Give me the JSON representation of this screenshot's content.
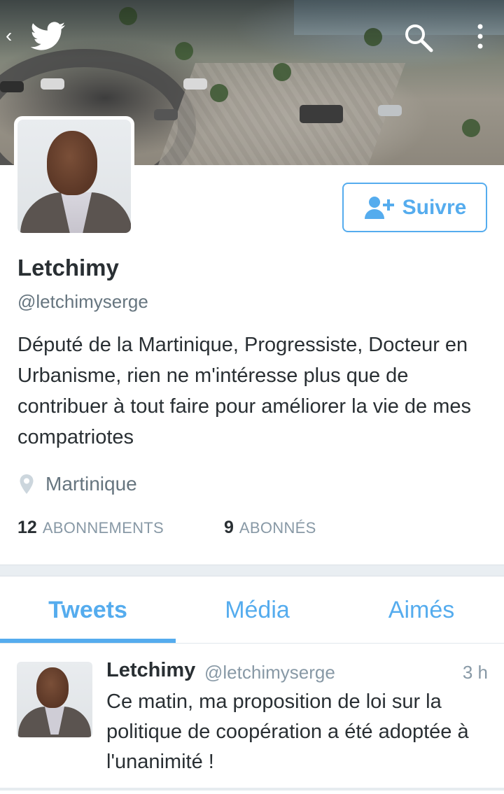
{
  "header": {
    "back_icon": "chevron-left-icon",
    "logo_icon": "twitter-bird-icon",
    "search_icon": "search-icon",
    "more_icon": "more-vertical-icon"
  },
  "profile": {
    "name": "Letchimy",
    "handle": "@letchimyserge",
    "bio": "Député de la Martinique, Progressiste, Docteur en Urbanisme, rien ne m'intéresse plus que de contribuer à  tout faire pour améliorer la vie de mes compatriotes",
    "location": "Martinique",
    "follow_button": "Suivre",
    "stats": {
      "following_count": "12",
      "following_label": "ABONNEMENTS",
      "followers_count": "9",
      "followers_label": "ABONNÉS"
    }
  },
  "tabs": [
    {
      "label": "Tweets",
      "active": true
    },
    {
      "label": "Média",
      "active": false
    },
    {
      "label": "Aimés",
      "active": false
    }
  ],
  "tweet": {
    "name": "Letchimy",
    "handle": "@letchimyserge",
    "time": "3 h",
    "text": "Ce matin, ma proposition de loi sur la politique de coopération a été adoptée à l'unanimité !"
  },
  "colors": {
    "accent": "#55acee",
    "text": "#292f33",
    "muted": "#66757f",
    "separator": "#e9eef2"
  }
}
